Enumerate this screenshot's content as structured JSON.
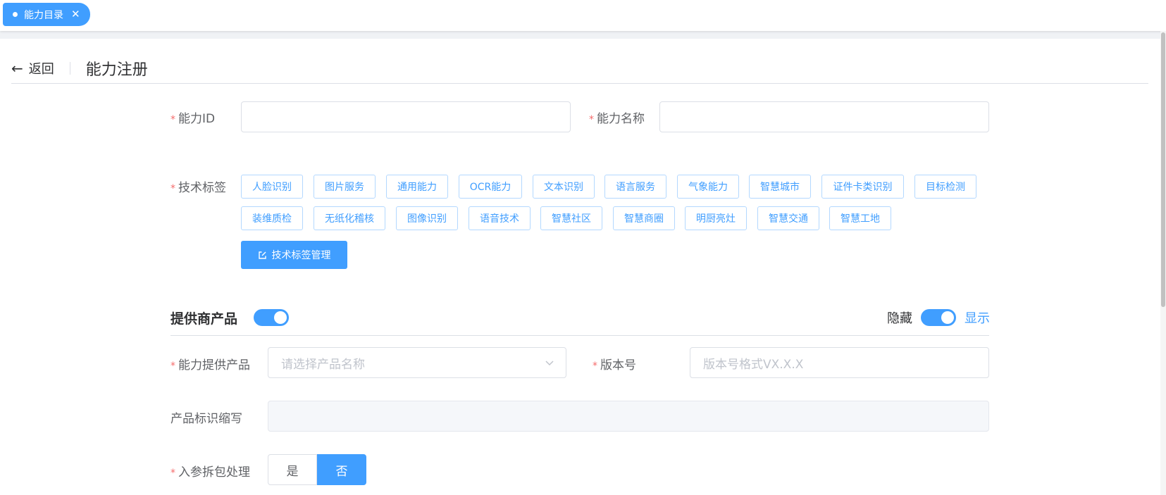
{
  "tabbar": {
    "active_tab": "能力目录",
    "close": "✕"
  },
  "header": {
    "back_label": "返回",
    "title": "能力注册"
  },
  "form": {
    "ability_id": {
      "label": "能力ID",
      "value": ""
    },
    "ability_name": {
      "label": "能力名称",
      "value": ""
    },
    "tech_tags": {
      "label": "技术标签",
      "tags": [
        "人脸识别",
        "图片服务",
        "通用能力",
        "OCR能力",
        "文本识别",
        "语言服务",
        "气象能力",
        "智慧城市",
        "证件卡类识别",
        "目标检测",
        "装维质检",
        "无纸化稽核",
        "图像识别",
        "语音技术",
        "智慧社区",
        "智慧商圈",
        "明厨亮灶",
        "智慧交通",
        "智慧工地"
      ],
      "manage_button": "技术标签管理"
    }
  },
  "provider": {
    "title": "提供商产品",
    "toggle_on": true,
    "hide_label": "隐藏",
    "show_label": "显示",
    "show_toggle_on": true,
    "product": {
      "label": "能力提供产品",
      "placeholder": "请选择产品名称"
    },
    "version": {
      "label": "版本号",
      "placeholder": "版本号格式VX.X.X"
    },
    "product_abbr": {
      "label": "产品标识缩写",
      "value": ""
    },
    "param_split": {
      "label": "入参拆包处理",
      "options": [
        "是",
        "否"
      ],
      "selected": "否"
    }
  },
  "colors": {
    "primary": "#409eff",
    "required": "#f56c6c",
    "border": "#dcdfe6"
  }
}
